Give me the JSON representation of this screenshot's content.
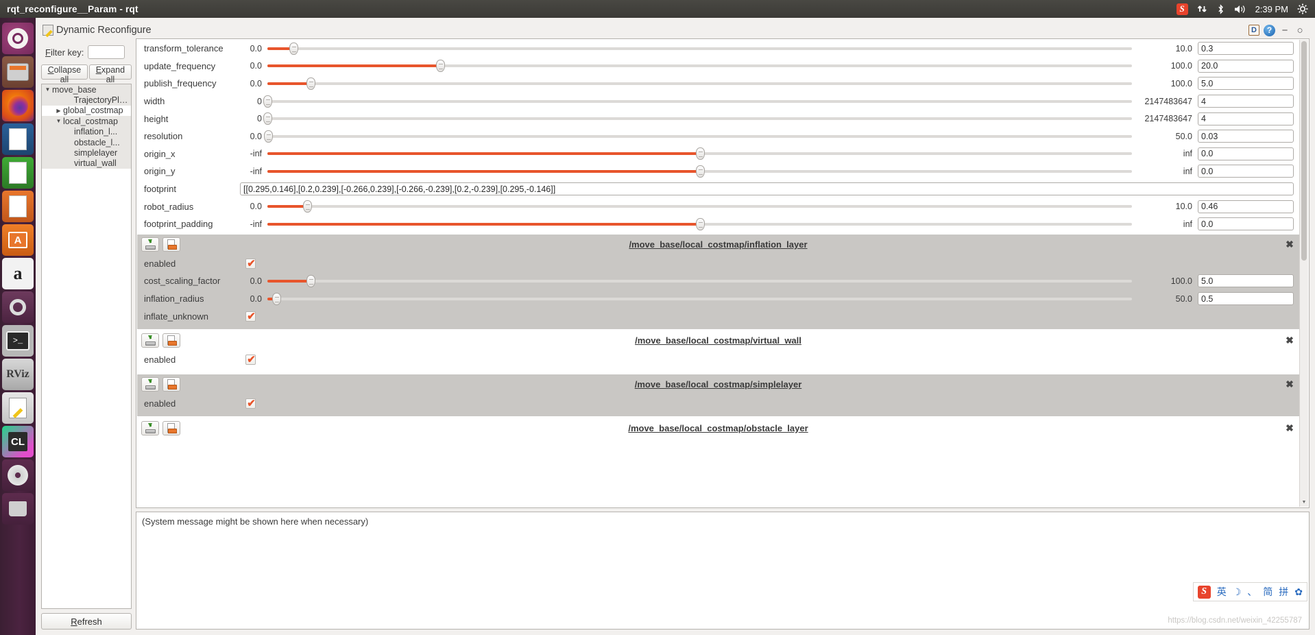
{
  "topbar": {
    "window_title": "rqt_reconfigure__Param - rqt",
    "tray": {
      "sogou_label": "S",
      "network_icon": "network-updown-icon",
      "bluetooth_icon": "bluetooth-icon",
      "volume_icon": "volume-icon",
      "time": "2:39 PM",
      "gear_icon": "system-gear-icon"
    }
  },
  "launcher": {
    "items": [
      {
        "name": "ubuntu-dash",
        "label": "",
        "running": false
      },
      {
        "name": "files",
        "label": "",
        "running": true
      },
      {
        "name": "firefox",
        "label": "",
        "running": false
      },
      {
        "name": "libreoffice-writer",
        "label": "",
        "running": false
      },
      {
        "name": "libreoffice-calc",
        "label": "",
        "running": false
      },
      {
        "name": "libreoffice-impress",
        "label": "",
        "running": false
      },
      {
        "name": "ubuntu-software",
        "label": "A",
        "running": false
      },
      {
        "name": "amazon",
        "label": "a",
        "running": false
      },
      {
        "name": "system-settings",
        "label": "",
        "running": false
      },
      {
        "name": "terminal",
        "label": ">_",
        "running": true
      },
      {
        "name": "rviz",
        "label": "RViz",
        "running": true
      },
      {
        "name": "text-editor",
        "label": "",
        "running": true
      },
      {
        "name": "clion",
        "label": "CL",
        "running": true
      },
      {
        "name": "dvd-writer",
        "label": "",
        "running": false
      },
      {
        "name": "trash",
        "label": "",
        "running": false
      }
    ]
  },
  "plugin": {
    "title": "Dynamic Reconfigure",
    "dock_label": "D",
    "help_label": "?",
    "minimize_label": "−",
    "maximize_label": "○"
  },
  "sidebar": {
    "filter_label_pre": "F",
    "filter_label_post": "ilter key:",
    "filter_value": "",
    "filter_placeholder": "",
    "collapse_label_pre": "C",
    "collapse_label_post": "ollapse all",
    "expand_label_pre": "E",
    "expand_label_post": "xpand all",
    "refresh_label_pre": "R",
    "refresh_label_post": "efresh",
    "tree": [
      {
        "label": "move_base",
        "depth": 1,
        "arrow": "▼",
        "selected": false
      },
      {
        "label": "TrajectoryPla...",
        "depth": 3,
        "arrow": "",
        "selected": false
      },
      {
        "label": "global_costmap",
        "depth": 2,
        "arrow": "▶",
        "selected": true
      },
      {
        "label": "local_costmap",
        "depth": 2,
        "arrow": "▼",
        "selected": false
      },
      {
        "label": "inflation_l...",
        "depth": 3,
        "arrow": "",
        "selected": false
      },
      {
        "label": "obstacle_l...",
        "depth": 3,
        "arrow": "",
        "selected": false
      },
      {
        "label": "simplelayer",
        "depth": 3,
        "arrow": "",
        "selected": false
      },
      {
        "label": "virtual_wall",
        "depth": 3,
        "arrow": "",
        "selected": false
      }
    ]
  },
  "params": {
    "rows": [
      {
        "name": "transform_tolerance",
        "min": "0.0",
        "max": "10.0",
        "value": "0.3",
        "type": "slider",
        "pos": 3.0
      },
      {
        "name": "update_frequency",
        "min": "0.0",
        "max": "100.0",
        "value": "20.0",
        "type": "slider",
        "pos": 20.0
      },
      {
        "name": "publish_frequency",
        "min": "0.0",
        "max": "100.0",
        "value": "5.0",
        "type": "slider",
        "pos": 5.0
      },
      {
        "name": "width",
        "min": "0",
        "max": "2147483647",
        "value": "4",
        "type": "slider",
        "pos": 0.0
      },
      {
        "name": "height",
        "min": "0",
        "max": "2147483647",
        "value": "4",
        "type": "slider",
        "pos": 0.0
      },
      {
        "name": "resolution",
        "min": "0.0",
        "max": "50.0",
        "value": "0.03",
        "type": "slider",
        "pos": 0.06
      },
      {
        "name": "origin_x",
        "min": "-inf",
        "max": "inf",
        "value": "0.0",
        "type": "slider",
        "pos": 50.0
      },
      {
        "name": "origin_y",
        "min": "-inf",
        "max": "inf",
        "value": "0.0",
        "type": "slider",
        "pos": 50.0
      },
      {
        "name": "footprint",
        "min": "",
        "max": "",
        "value": "[[0.295,0.146],[0.2,0.239],[-0.266,0.239],[-0.266,-0.239],[0.2,-0.239],[0.295,-0.146]]",
        "type": "text",
        "pos": 0
      },
      {
        "name": "robot_radius",
        "min": "0.0",
        "max": "10.0",
        "value": "0.46",
        "type": "slider",
        "pos": 4.6
      },
      {
        "name": "footprint_padding",
        "min": "-inf",
        "max": "inf",
        "value": "0.0",
        "type": "slider",
        "pos": 50.0
      }
    ]
  },
  "groups": [
    {
      "title": "/move_base/local_costmap/inflation_layer",
      "save_icon": "save-icon",
      "open_icon": "open-file-icon",
      "close_label": "✖",
      "rows": [
        {
          "name": "enabled",
          "type": "checkbox",
          "checked": true
        },
        {
          "name": "cost_scaling_factor",
          "type": "slider",
          "min": "0.0",
          "max": "100.0",
          "value": "5.0",
          "pos": 5.0
        },
        {
          "name": "inflation_radius",
          "type": "slider",
          "min": "0.0",
          "max": "50.0",
          "value": "0.5",
          "pos": 1.0
        },
        {
          "name": "inflate_unknown",
          "type": "checkbox",
          "checked": true
        }
      ]
    },
    {
      "title": "/move_base/local_costmap/virtual_wall",
      "save_icon": "save-icon",
      "open_icon": "open-file-icon",
      "close_label": "✖",
      "rows": [
        {
          "name": "enabled",
          "type": "checkbox",
          "checked": true
        }
      ]
    },
    {
      "title": "/move_base/local_costmap/simplelayer",
      "save_icon": "save-icon",
      "open_icon": "open-file-icon",
      "close_label": "✖",
      "rows": [
        {
          "name": "enabled",
          "type": "checkbox",
          "checked": true
        }
      ]
    },
    {
      "title": "/move_base/local_costmap/obstacle_layer",
      "save_icon": "save-icon",
      "open_icon": "open-file-icon",
      "close_label": "✖",
      "rows": []
    }
  ],
  "status": {
    "message": "(System message might be shown here when necessary)"
  },
  "sogou": {
    "logo": "S",
    "items": [
      "英",
      "☽",
      "、",
      "简",
      "拼",
      "✿"
    ]
  },
  "watermark": "https://blog.csdn.net/weixin_42255787",
  "colors": {
    "accent_orange": "#e8552c",
    "panel_bg": "#3c3b37",
    "launcher_bg": "#4b2340",
    "group_alt_bg": "#c9c7c4"
  }
}
